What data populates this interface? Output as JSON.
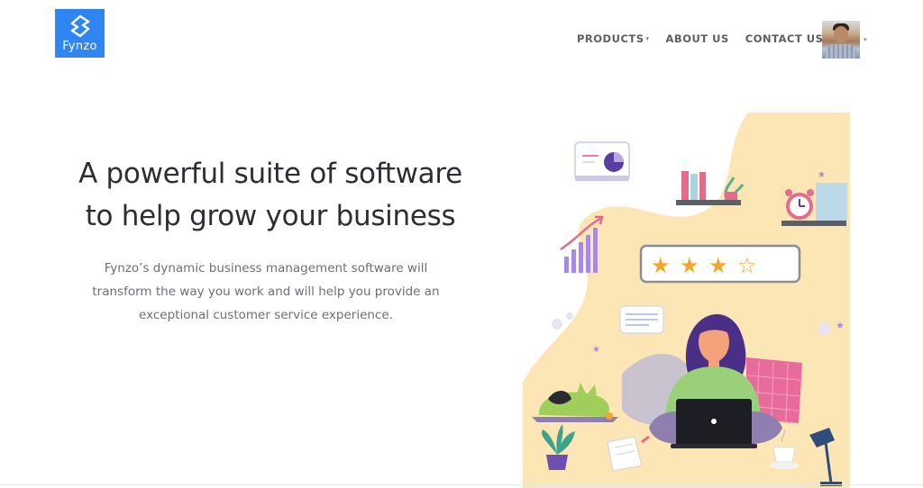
{
  "brand": {
    "name": "Fynzo",
    "color": "#2f86f2"
  },
  "nav": {
    "items": [
      {
        "label": "PRODUCTS",
        "has_dropdown": true
      },
      {
        "label": "ABOUT US",
        "has_dropdown": false
      },
      {
        "label": "CONTACT US",
        "has_dropdown": false
      }
    ]
  },
  "hero": {
    "title_line1": "A powerful suite of software",
    "title_line2": "to help grow your business",
    "subtitle_line1": "Fynzo’s dynamic business management software will",
    "subtitle_line2": "transform the way you work and will help you provide an",
    "subtitle_line3": "exceptional customer service experience."
  },
  "rating": {
    "value": 3,
    "max": 4
  },
  "icons": [
    "fynzo-logo-icon",
    "chevron-down-icon",
    "user-avatar",
    "star-icon",
    "alarm-clock-icon",
    "laptop-icon",
    "lamp-icon",
    "plant-icon",
    "pie-chart-card-icon",
    "growth-chart-icon",
    "chat-bubble-icon",
    "coffee-cup-icon",
    "books-icon"
  ],
  "colors": {
    "text_dark": "#2b2f33",
    "text_muted": "#6a6f75",
    "nav_text": "#5a5f66",
    "illustration_bg": "#fde6b5",
    "accent_purple": "#5b3fa0",
    "star": "#f4a62a"
  }
}
